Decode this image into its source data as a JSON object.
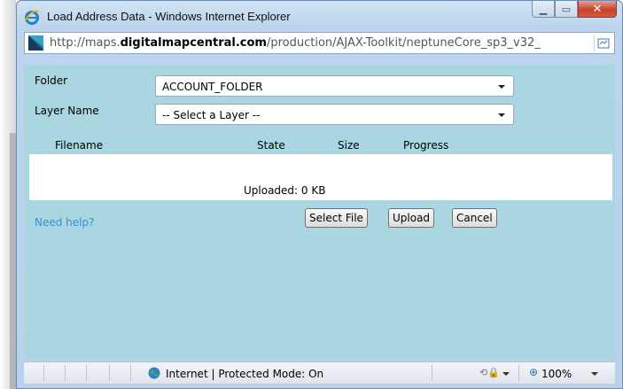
{
  "window": {
    "title": "Load Address Data - Windows Internet Explorer",
    "caption_minimize": "▁",
    "caption_maximize": "▭",
    "caption_close": "✕"
  },
  "address": {
    "prefix": "http://maps.",
    "domain": "digitalmapcentral.com",
    "path": "/production/AJAX-Toolkit/neptuneCore_sp3_v32_",
    "compat_icon": "compatibility-view-icon"
  },
  "form": {
    "folder_label": "Folder",
    "folder_value": "ACCOUNT_FOLDER",
    "layer_label": "Layer Name",
    "layer_value": "-- Select a Layer --"
  },
  "table": {
    "headers": [
      "Filename",
      "State",
      "Size",
      "Progress"
    ],
    "uploaded_text": "Uploaded: 0 KB"
  },
  "actions": {
    "help_link": "Need help?",
    "select_file": "Select File",
    "upload": "Upload",
    "cancel": "Cancel"
  },
  "status": {
    "zone": "Internet | Protected Mode: On",
    "zoom": "100%"
  },
  "colors": {
    "content_bg": "#a9d6e1",
    "link": "#3b8fc9",
    "close_button": "#c5432b"
  }
}
